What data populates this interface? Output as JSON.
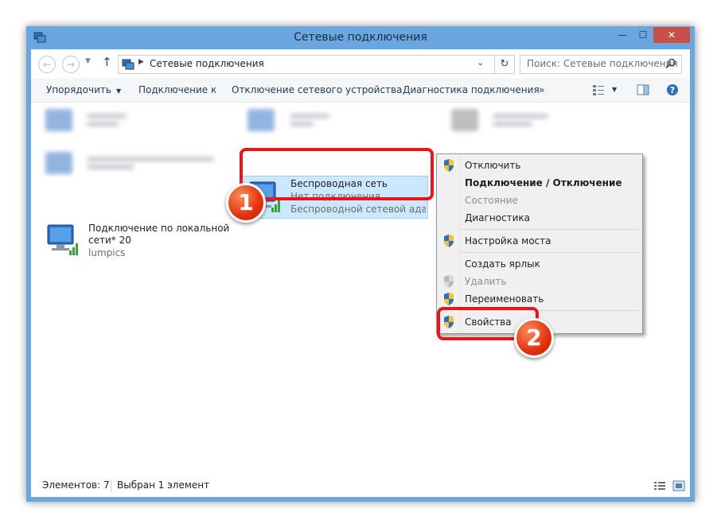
{
  "window": {
    "title": "Сетевые подключения",
    "close_label": "✕",
    "min_label": "—",
    "max_label": "☐"
  },
  "address": {
    "path": "Сетевые подключения",
    "search_placeholder": "Поиск: Сетевые подключения"
  },
  "toolbar": {
    "organize": "Упорядочить",
    "connect_to": "Подключение к",
    "disable_device": "Отключение сетевого устройства",
    "diagnose": "Диагностика подключения",
    "more": "»"
  },
  "items": {
    "wireless": {
      "name": "Беспроводная сеть",
      "status": "Нет подключения",
      "adapter": "Беспроводной сетевой адаптер..."
    },
    "local": {
      "name_line1": "Подключение по локальной",
      "name_line2": "сети* 20",
      "sub": "lumpics"
    }
  },
  "context_menu": {
    "items": [
      {
        "label": "Отключить"
      },
      {
        "label": "Подключение / Отключение"
      },
      {
        "label": "Состояние"
      },
      {
        "label": "Диагностика"
      },
      {
        "label": "Настройка моста"
      },
      {
        "label": "Создать ярлык"
      },
      {
        "label": "Удалить"
      },
      {
        "label": "Переименовать"
      },
      {
        "label": "Свойства"
      }
    ]
  },
  "annotations": {
    "step1": "1",
    "step2": "2"
  },
  "status": {
    "count": "Элементов: 7",
    "selected": "Выбран 1 элемент"
  },
  "colors": {
    "accent": "#6aa6e0",
    "close": "#c7504a",
    "callout": "#e8151b",
    "selection": "#cce8ff"
  }
}
